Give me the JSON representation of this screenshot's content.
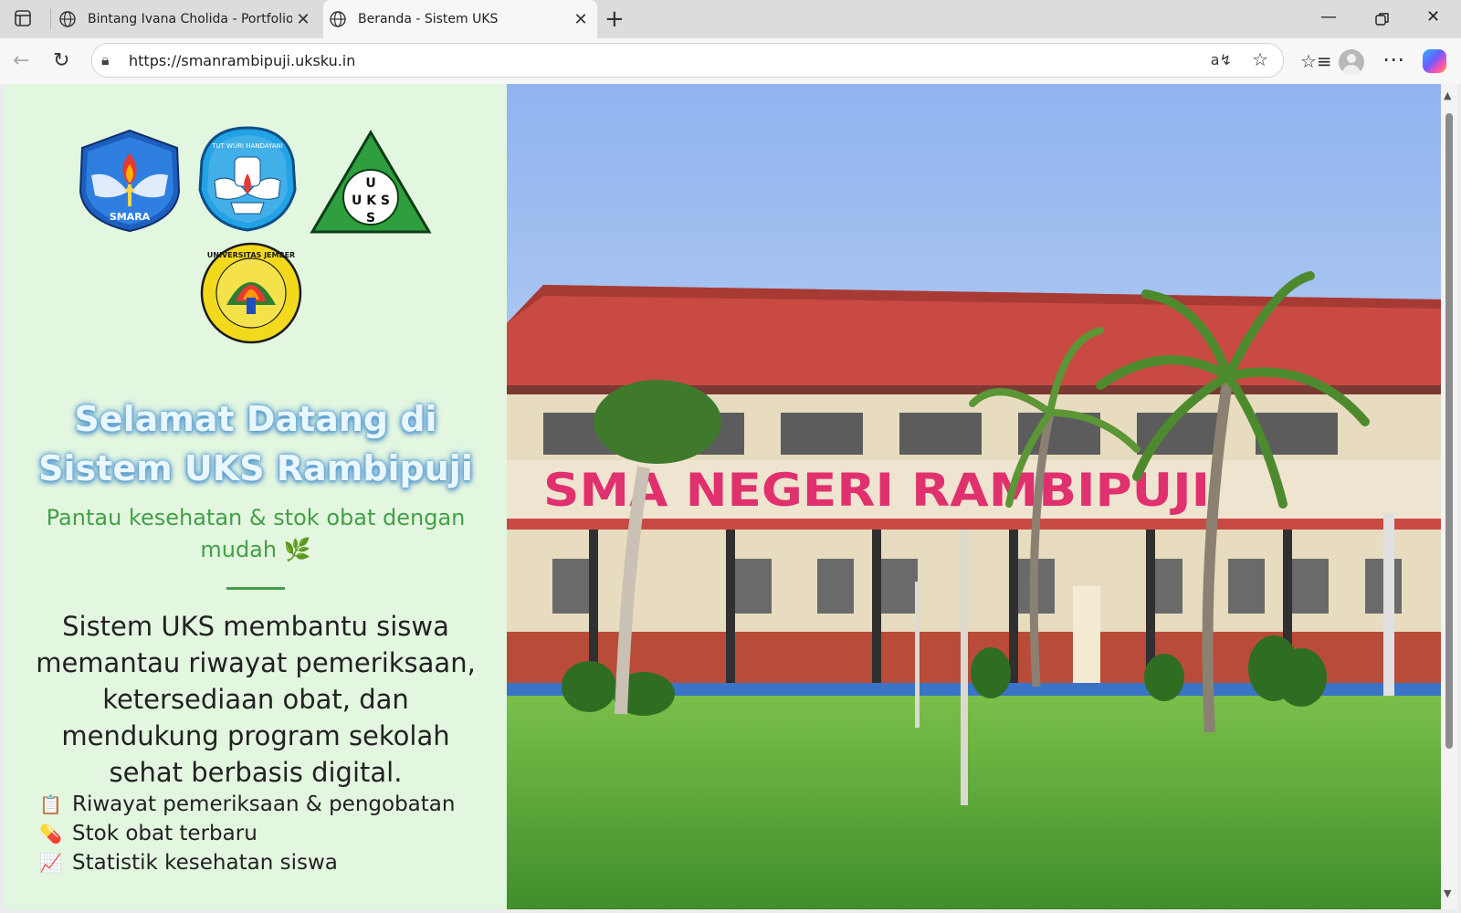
{
  "browser": {
    "tabs": [
      {
        "title": "Bintang Ivana Cholida - Portfolio",
        "active": false
      },
      {
        "title": "Beranda - Sistem UKS",
        "active": true
      }
    ],
    "url": "https://smanrambipuji.uksku.in"
  },
  "logos": [
    {
      "name": "smara-logo",
      "text": "SMARA"
    },
    {
      "name": "tut-wuri-handayani-logo",
      "text": "TUT WURI HANDAYANI"
    },
    {
      "name": "uks-logo",
      "text": "U K S"
    },
    {
      "name": "universitas-jember-logo",
      "text": "UNIVERSITAS JEMBER"
    }
  ],
  "hero": {
    "title": "Selamat Datang di Sistem UKS Rambipuji",
    "subtitle": "Pantau kesehatan & stok obat dengan mudah 🌿",
    "description": "Sistem UKS membantu siswa memantau riwayat pemeriksaan, ketersediaan obat, dan mendukung program sekolah sehat berbasis digital.",
    "features": [
      {
        "icon": "📋",
        "label": "Riwayat pemeriksaan & pengobatan"
      },
      {
        "icon": "💊",
        "label": "Stok obat terbaru"
      },
      {
        "icon": "📈",
        "label": "Statistik kesehatan siswa"
      }
    ]
  },
  "photo": {
    "sign_text": "SMA NEGERI RAMBIPUJI"
  },
  "colors": {
    "panel_bg": "#e3f6e0",
    "accent_green": "#43a047",
    "title_glow": "#5aa0d8",
    "roof_red": "#c94a43",
    "sign_pink": "#e0306e"
  }
}
